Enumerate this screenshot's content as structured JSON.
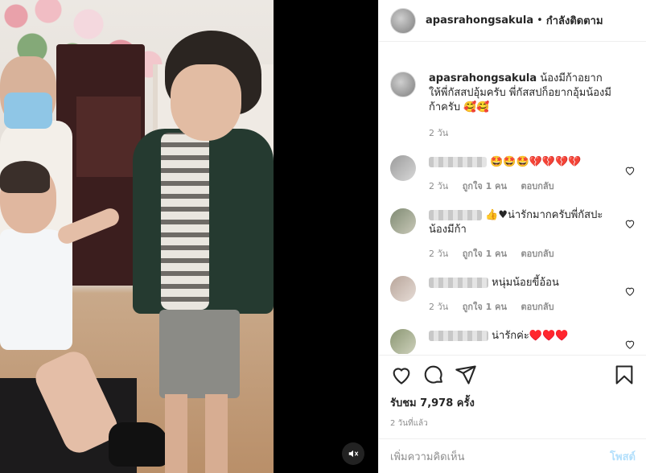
{
  "header": {
    "username": "apasrahongsakula",
    "separator": "•",
    "follow_status": "กำลังติดตาม"
  },
  "caption": {
    "username": "apasrahongsakula",
    "text": "น้องมีก้าอยากให้พี่กัสสปอุ้มครับ พี่กัสสปก็อยากอุ้มน้องมีก้าครับ 🥰🥰",
    "time": "2 วัน"
  },
  "comments": [
    {
      "text": "🤩🤩🤩💔💔💔💔",
      "time": "2 วัน",
      "likes": "ถูกใจ 1 คน",
      "reply": "ตอบกลับ"
    },
    {
      "text": "👍♥น่ารักมากครับพี่กัสปะน้องมีก้า",
      "time": "2 วัน",
      "likes": "ถูกใจ 1 คน",
      "reply": "ตอบกลับ"
    },
    {
      "text": "หนุ่มน้อยขี้อ้อน",
      "time": "2 วัน",
      "likes": "ถูกใจ 1 คน",
      "reply": "ตอบกลับ"
    },
    {
      "text": "น่ารักค่ะ♥️♥️♥️"
    }
  ],
  "stats": {
    "views": "รับชม 7,978 ครั้ง",
    "posted": "2 วันที่แล้ว"
  },
  "add_comment": {
    "placeholder": "เพิ่มความคิดเห็น",
    "post_label": "โพสต์"
  },
  "colors": {
    "accent": "#0095f6",
    "post_disabled": "#b2dffc",
    "secondary_text": "#8e8e8e"
  },
  "icons": [
    "like-icon",
    "comment-icon",
    "share-icon",
    "save-icon",
    "volume-icon",
    "small-heart-icon"
  ]
}
